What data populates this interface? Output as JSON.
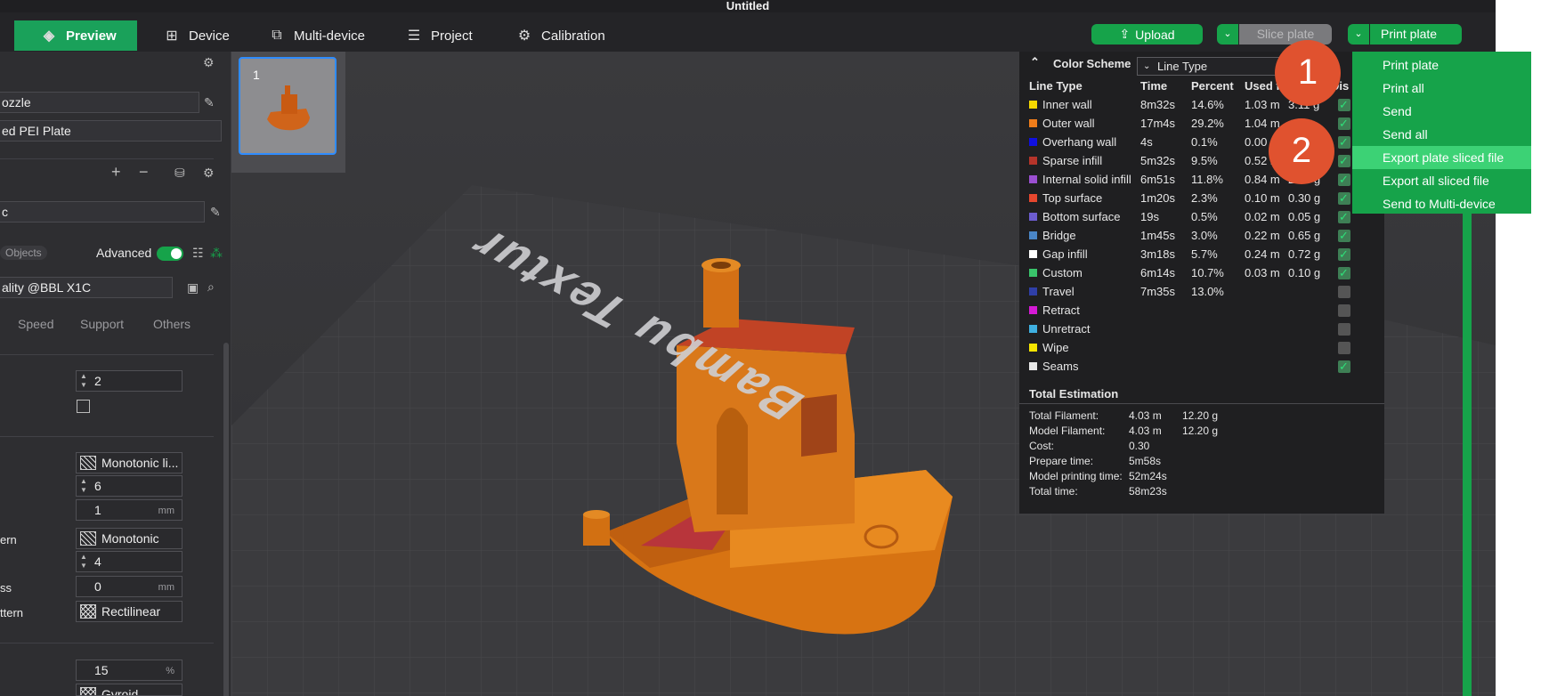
{
  "window": {
    "title": "Untitled"
  },
  "tabs": [
    {
      "label": "Preview",
      "icon": "layers-icon"
    },
    {
      "label": "Device",
      "icon": "device-icon"
    },
    {
      "label": "Multi-device",
      "icon": "multi-device-icon"
    },
    {
      "label": "Project",
      "icon": "project-icon"
    },
    {
      "label": "Calibration",
      "icon": "calibration-icon"
    }
  ],
  "actions": {
    "upload": "Upload",
    "slice_plate": "Slice plate",
    "print_plate": "Print plate"
  },
  "print_menu": {
    "items": [
      "Print plate",
      "Print all",
      "Send",
      "Send all",
      "Export plate sliced file",
      "Export all sliced file",
      "Send to Multi-device"
    ],
    "highlighted": "Export plate sliced file"
  },
  "callouts": [
    "1",
    "2"
  ],
  "sidebar": {
    "nozzle_field": "ozzle",
    "plate_field": "ed PEI Plate",
    "filament_field": "c",
    "objects_toggle": "Objects",
    "advanced_label": "Advanced",
    "process_field": "ality @BBL X1C",
    "tabs": [
      "Speed",
      "Support",
      "Others"
    ],
    "fields": {
      "wall_loops": "2",
      "top_pattern": "Monotonic li...",
      "top_layers": "6",
      "top_thickness": "1",
      "bottom_label": "ern",
      "bottom_pattern": "Monotonic",
      "bottom_layers": "4",
      "ss_label": "ss",
      "bottom_thickness": "0",
      "internal_label": "ttern",
      "internal_pattern": "Rectilinear",
      "infill_density": "15",
      "sparse_pattern": "Gyroid"
    },
    "units": {
      "mm": "mm",
      "percent": "%"
    }
  },
  "plate": {
    "number": "1"
  },
  "bed_label": "Bambu Textur",
  "color_scheme": {
    "title": "Color Scheme",
    "selected": "Line Type",
    "headers": [
      "Line Type",
      "Time",
      "Percent",
      "Used fi",
      "",
      "Dis"
    ],
    "rows": [
      {
        "name": "Inner wall",
        "color": "#f5d800",
        "time": "8m32s",
        "percent": "14.6%",
        "length": "1.03 m",
        "weight": "3.11 g",
        "on": true
      },
      {
        "name": "Outer wall",
        "color": "#f07d1a",
        "time": "17m4s",
        "percent": "29.2%",
        "length": "1.04 m",
        "weight": "",
        "on": true
      },
      {
        "name": "Overhang wall",
        "color": "#1010e0",
        "time": "4s",
        "percent": "0.1%",
        "length": "0.00",
        "weight": "",
        "on": true
      },
      {
        "name": "Sparse infill",
        "color": "#b5342a",
        "time": "5m32s",
        "percent": "9.5%",
        "length": "0.52 m",
        "weight": "",
        "on": true
      },
      {
        "name": "Internal solid infill",
        "color": "#9b4fd1",
        "time": "6m51s",
        "percent": "11.8%",
        "length": "0.84 m",
        "weight": "2.54 g",
        "on": true
      },
      {
        "name": "Top surface",
        "color": "#e6472e",
        "time": "1m20s",
        "percent": "2.3%",
        "length": "0.10 m",
        "weight": "0.30 g",
        "on": true
      },
      {
        "name": "Bottom surface",
        "color": "#6c5ccf",
        "time": "19s",
        "percent": "0.5%",
        "length": "0.02 m",
        "weight": "0.05 g",
        "on": true
      },
      {
        "name": "Bridge",
        "color": "#4a86c7",
        "time": "1m45s",
        "percent": "3.0%",
        "length": "0.22 m",
        "weight": "0.65 g",
        "on": true
      },
      {
        "name": "Gap infill",
        "color": "#ffffff",
        "time": "3m18s",
        "percent": "5.7%",
        "length": "0.24 m",
        "weight": "0.72 g",
        "on": true
      },
      {
        "name": "Custom",
        "color": "#39c46b",
        "time": "6m14s",
        "percent": "10.7%",
        "length": "0.03 m",
        "weight": "0.10 g",
        "on": true
      },
      {
        "name": "Travel",
        "color": "#2f3fa8",
        "time": "7m35s",
        "percent": "13.0%",
        "length": "",
        "weight": "",
        "on": false
      },
      {
        "name": "Retract",
        "color": "#d51ad5",
        "time": "",
        "percent": "",
        "length": "",
        "weight": "",
        "on": false
      },
      {
        "name": "Unretract",
        "color": "#3fb0e0",
        "time": "",
        "percent": "",
        "length": "",
        "weight": "",
        "on": false
      },
      {
        "name": "Wipe",
        "color": "#f5e400",
        "time": "",
        "percent": "",
        "length": "",
        "weight": "",
        "on": false
      },
      {
        "name": "Seams",
        "color": "#e8e8e8",
        "time": "",
        "percent": "",
        "length": "",
        "weight": "",
        "on": true
      }
    ],
    "total_title": "Total Estimation",
    "totals": [
      {
        "label": "Total Filament:",
        "v1": "4.03 m",
        "v2": "12.20 g"
      },
      {
        "label": "Model Filament:",
        "v1": "4.03 m",
        "v2": "12.20 g"
      },
      {
        "label": "Cost:",
        "v1": "0.30",
        "v2": ""
      },
      {
        "label": "Prepare time:",
        "v1": "5m58s",
        "v2": ""
      },
      {
        "label": "Model printing time:",
        "v1": "52m24s",
        "v2": ""
      },
      {
        "label": "Total time:",
        "v1": "58m23s",
        "v2": ""
      }
    ]
  }
}
